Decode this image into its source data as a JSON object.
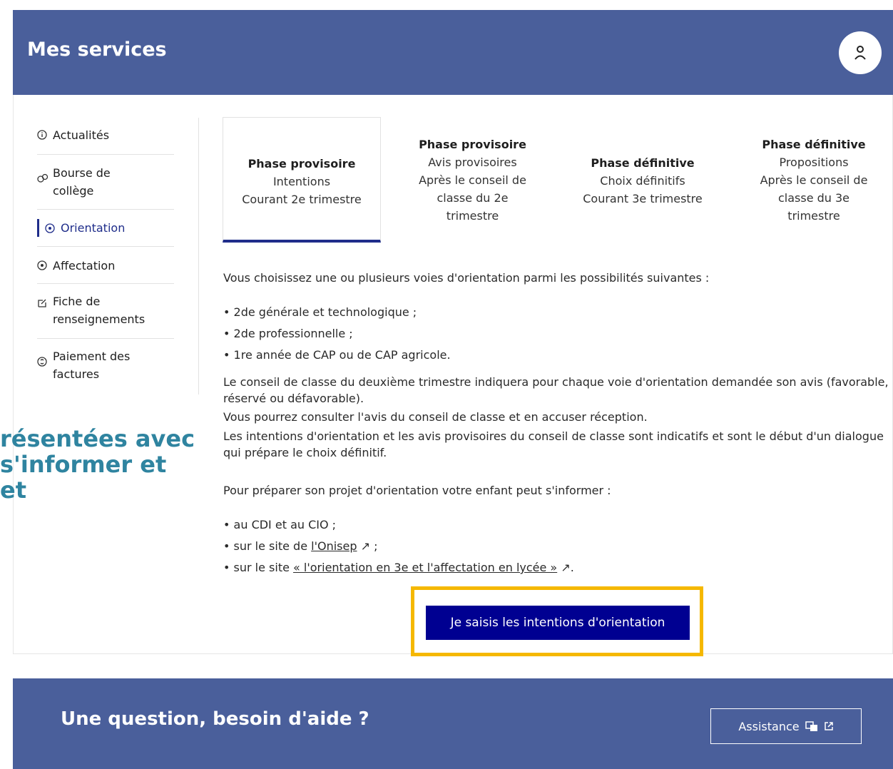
{
  "header": {
    "title": "Mes services"
  },
  "sidebar": {
    "items": [
      {
        "label": "Actualités",
        "icon": "info-circle-icon"
      },
      {
        "label": "Bourse de collège",
        "icon": "euro-coins-icon"
      },
      {
        "label": "Orientation",
        "icon": "compass-icon",
        "active": true
      },
      {
        "label": "Affectation",
        "icon": "compass-icon"
      },
      {
        "label": "Fiche de renseignements",
        "icon": "edit-icon"
      },
      {
        "label": "Paiement des factures",
        "icon": "payment-icon"
      }
    ]
  },
  "tabs": [
    {
      "title": "Phase provisoire",
      "line1": "Intentions",
      "line2": "Courant 2e trimestre"
    },
    {
      "title": "Phase provisoire",
      "line1": "Avis provisoires",
      "line2": "Après le conseil de classe du 2e trimestre"
    },
    {
      "title": "Phase définitive",
      "line1": "Choix définitifs",
      "line2": "Courant 3e trimestre"
    },
    {
      "title": "Phase définitive",
      "line1": "Propositions",
      "line2": "Après le conseil de classe du 3e trimestre"
    }
  ],
  "content": {
    "intro": "Vous choisissez une ou plusieurs voies d'orientation parmi les possibilités suivantes :",
    "options": [
      "2de générale et technologique ;",
      "2de professionnelle ;",
      "1re année de CAP ou de CAP agricole."
    ],
    "para1": "Le conseil de classe du deuxième trimestre indiquera pour chaque voie d'orientation demandée son avis (favorable, réservé ou défavorable).",
    "para2": "Vous pourrez consulter l'avis du conseil de classe et en accuser réception.",
    "para3": "Les intentions d'orientation et les avis provisoires du conseil de classe sont indicatifs et sont le début d'un dialogue qui prépare le choix définitif.",
    "prep": "Pour préparer son projet d'orientation votre enfant peut s'informer :",
    "resource1": "au CDI et au CIO ;",
    "resource2_prefix": "sur le site de ",
    "resource2_link": "l'Onisep",
    "resource3_prefix": "sur le site ",
    "resource3_link": "« l'orientation en 3e et l'affectation en lycée »"
  },
  "overlay": {
    "line1": "résentées avec",
    "line2": "s'informer et",
    "line3": "et"
  },
  "cta": {
    "label": "Je saisis les intentions d'orientation"
  },
  "footer": {
    "title": "Une question, besoin d'aide ?",
    "assist_label": "Assistance"
  }
}
